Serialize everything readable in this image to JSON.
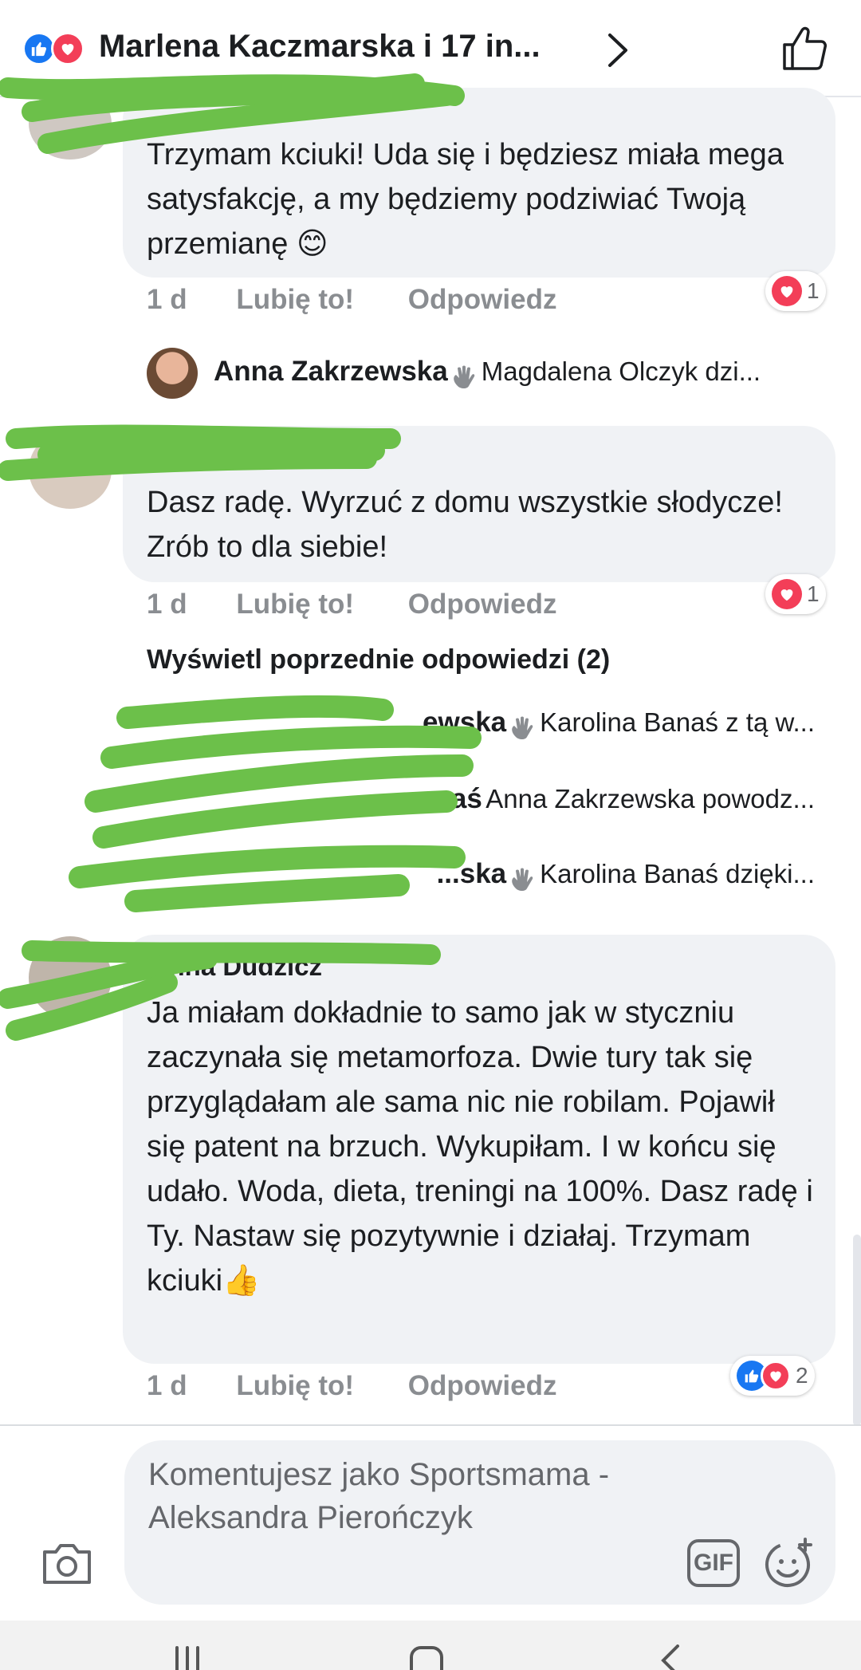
{
  "header": {
    "title": "Marlena Kaczmarska i 17 in...",
    "reactions": [
      "like-icon",
      "love-icon"
    ]
  },
  "comments": [
    {
      "text": "Trzymam kciuki! Uda się i będziesz miała mega satysfakcję, a my będziemy podziwiać Twoją przemianę 😊",
      "time": "1 d",
      "like_label": "Lubię to!",
      "reply_label": "Odpowiedz",
      "reaction_count": "1"
    },
    {
      "text": "Dasz radę. Wyrzuć z domu wszystkie słodycze! Zrób to dla siebie!",
      "time": "1 d",
      "like_label": "Lubię to!",
      "reply_label": "Odpowiedz",
      "reaction_count": "1"
    },
    {
      "author_partial": "...nna Dudzicz",
      "text": "Ja miałam dokładnie to samo jak w styczniu zaczynała się metamorfoza. Dwie tury tak się przyglądałam ale sama nic nie robilam. Pojawił się patent na brzuch. Wykupiłam. I w końcu się udało. Woda, dieta, treningi na 100%. Dasz radę i Ty. Nastaw się pozytywnie i działaj. Trzymam kciuki👍",
      "time": "1 d",
      "like_label": "Lubię to!",
      "reply_label": "Odpowiedz",
      "reaction_count": "2"
    }
  ],
  "replies": [
    {
      "name": "Anna Zakrzewska",
      "text": "Magdalena Olczyk dzi..."
    },
    {
      "name": "...ewska",
      "text": "Karolina Banaś z tą w..."
    },
    {
      "name": "...anaś",
      "text": "Anna Zakrzewska powodz..."
    },
    {
      "name": "...ska",
      "text": "Karolina Banaś dzięki..."
    }
  ],
  "view_previous": "Wyświetl poprzednie odpowiedzi (2)",
  "composer": {
    "placeholder": "Komentujesz jako Sportsmama - Aleksandra Pierończyk",
    "gif_label": "GIF"
  },
  "colors": {
    "like_blue": "#1877f2",
    "love_red": "#f33e58",
    "scribble_green": "#6cc04a",
    "meta_gray": "#8a8d91",
    "bubble_bg": "#f0f2f5"
  }
}
